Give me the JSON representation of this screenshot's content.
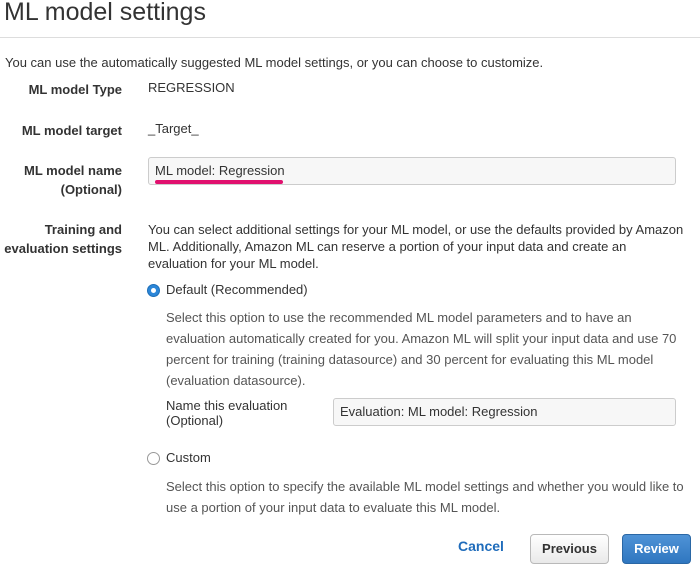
{
  "page": {
    "title": "ML model settings",
    "intro": "You can use the automatically suggested ML model settings, or you can choose to customize."
  },
  "fields": {
    "model_type": {
      "label": "ML model Type",
      "value": "REGRESSION"
    },
    "model_target": {
      "label": "ML model target",
      "value": "_Target_"
    },
    "model_name": {
      "label_line1": "ML model name",
      "label_line2": "(Optional)",
      "value": "ML model: Regression"
    }
  },
  "training": {
    "label_line1": "Training and",
    "label_line2": "evaluation settings",
    "description_lines": [
      "You can select additional settings for your ML model, or use the defaults provided by Amazon",
      "ML. Additionally, Amazon ML can reserve a portion of your input data and create an",
      "evaluation for your ML model."
    ],
    "default_option": {
      "label": "Default (Recommended)",
      "selected": true,
      "help_lines": [
        "Select this option to use the recommended ML model parameters and to have an",
        "evaluation automatically created for you. Amazon ML will split your input data and use 70",
        "percent for training (training datasource) and 30 percent for evaluating this ML model",
        "(evaluation datasource)."
      ],
      "eval_name_label_line1": "Name this evaluation",
      "eval_name_label_line2": "(Optional)",
      "eval_name_value": "Evaluation: ML model: Regression"
    },
    "custom_option": {
      "label": "Custom",
      "selected": false,
      "help_lines": [
        "Select this option to specify the available ML model settings and whether you would like to",
        "use a portion of your input data to evaluate this ML model."
      ]
    }
  },
  "actions": {
    "cancel": "Cancel",
    "previous": "Previous",
    "review": "Review"
  },
  "colors": {
    "accent_blue": "#2f77c0",
    "highlight_underline": "#e0106e",
    "link_blue": "#1f6cbb"
  }
}
